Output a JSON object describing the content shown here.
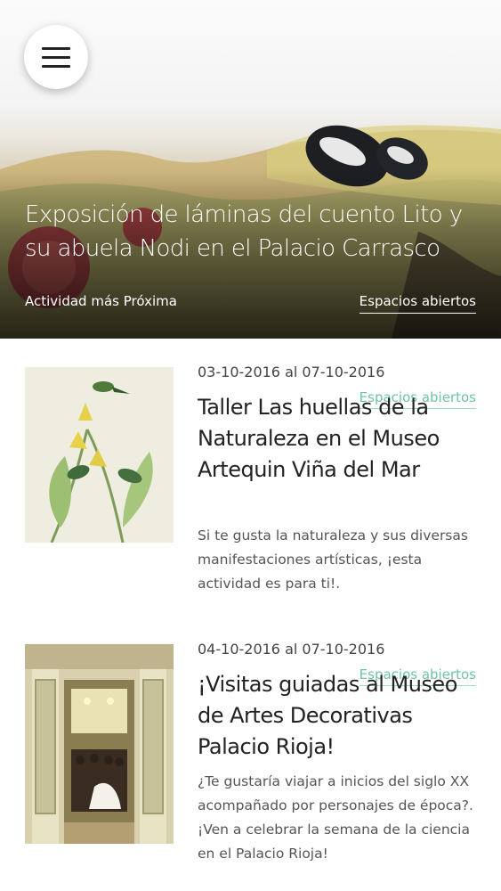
{
  "hero": {
    "title": "Exposición de láminas del cuento Lito y su abuela Nodi en el Palacio Carrasco",
    "label": "Actividad más Próxima",
    "tag": "Espacios abiertos"
  },
  "menu": {
    "icon": "hamburger-menu-icon"
  },
  "events": [
    {
      "date": "03-10-2016 al 07-10-2016",
      "tag": "Espacios abiertos",
      "title": "Taller Las huellas de la Naturaleza en el Museo Artequin Viña del Mar",
      "description": "Si te gusta la naturaleza y sus diversas manifestaciones artísticas, ¡esta actividad es para ti!."
    },
    {
      "date": "04-10-2016 al 07-10-2016",
      "tag": "Espacios abiertos",
      "title": "¡Visitas guiadas al Museo de Artes Decorativas Palacio Rioja!",
      "description": "¿Te gustaría viajar a inicios del siglo XX acompañado por personajes de época?. ¡Ven a celebrar la semana de la ciencia en el Palacio Rioja!"
    }
  ],
  "colors": {
    "accent": "#6fc4a6",
    "text": "#222222",
    "background": "#ffffff"
  }
}
